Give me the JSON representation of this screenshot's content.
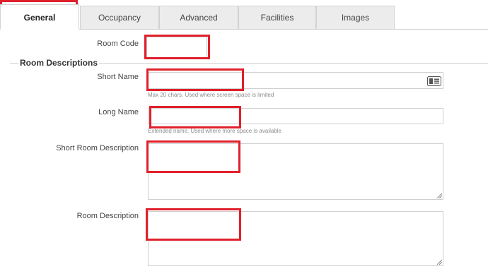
{
  "tabs": [
    {
      "label": "General",
      "active": true
    },
    {
      "label": "Occupancy",
      "active": false
    },
    {
      "label": "Advanced",
      "active": false
    },
    {
      "label": "Facilities",
      "active": false
    },
    {
      "label": "Images",
      "active": false
    }
  ],
  "room_code": {
    "label": "Room Code",
    "value": ""
  },
  "section": {
    "title": "Room Descriptions"
  },
  "short_name": {
    "label": "Short Name",
    "value": "",
    "hint": "Max 20 chars. Used where screen space is limited"
  },
  "long_name": {
    "label": "Long Name",
    "value": "",
    "hint": "Extended name. Used where more space is available"
  },
  "short_room_description": {
    "label": "Short Room Description",
    "value": ""
  },
  "room_description": {
    "label": "Room Description",
    "value": ""
  },
  "colors": {
    "highlight": "#e0202b",
    "tab_bg": "#ececec",
    "border": "#cfcfcf"
  }
}
